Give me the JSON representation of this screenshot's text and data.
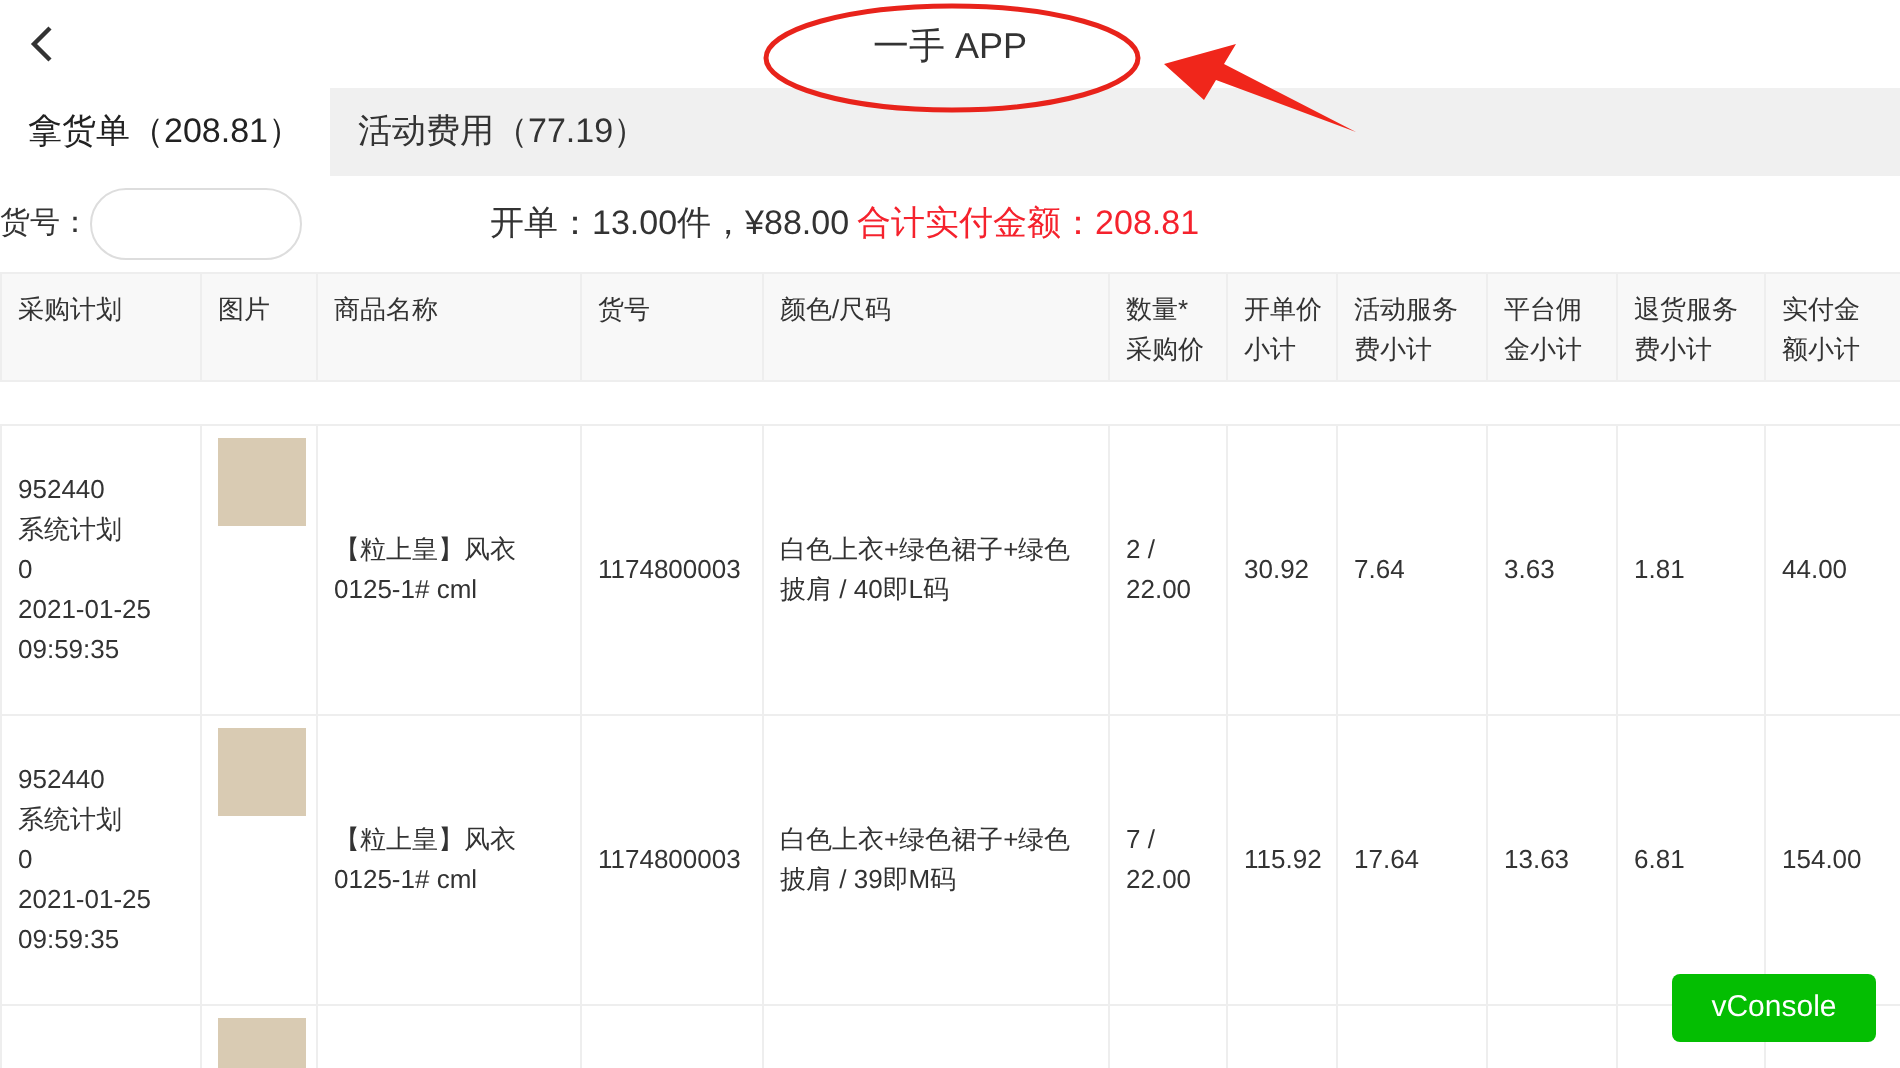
{
  "header": {
    "title": "一手 APP"
  },
  "tabs": [
    {
      "label": "拿货单（208.81）",
      "selected": true
    },
    {
      "label": "活动费用（77.19）",
      "selected": false
    }
  ],
  "filter": {
    "label": "货号："
  },
  "summary": {
    "text": "开单：13.00件，¥88.00",
    "total": "合计实付金额：208.81"
  },
  "table": {
    "columns": [
      "采购计划",
      "图片",
      "商品名称",
      "货号",
      "颜色/尺码",
      "数量*\n采购价",
      "开单价小计",
      "活动服务费小计",
      "平台佣金小计",
      "退货服务费小计",
      "实付金额小计"
    ],
    "rows": [
      {
        "plan": "952440\n系统计划\n0\n2021-01-25\n09:59:35",
        "name": "【粒上皇】风衣\n0125-1# cml",
        "sku": "1174800003",
        "variant": "白色上衣+绿色裙子+绿色披肩 / 40即L码",
        "qty": "2 /\n22.00",
        "open": "30.92",
        "activity": "7.64",
        "commission": "3.63",
        "returns": "1.81",
        "paid": "44.00"
      },
      {
        "plan": "952440\n系统计划\n0\n2021-01-25\n09:59:35",
        "name": "【粒上皇】风衣\n0125-1# cml",
        "sku": "1174800003",
        "variant": "白色上衣+绿色裙子+绿色披肩 / 39即M码",
        "qty": "7 /\n22.00",
        "open": "115.92",
        "activity": "17.64",
        "commission": "13.63",
        "returns": "6.81",
        "paid": "154.00"
      },
      {}
    ]
  },
  "console_button": "vConsole"
}
